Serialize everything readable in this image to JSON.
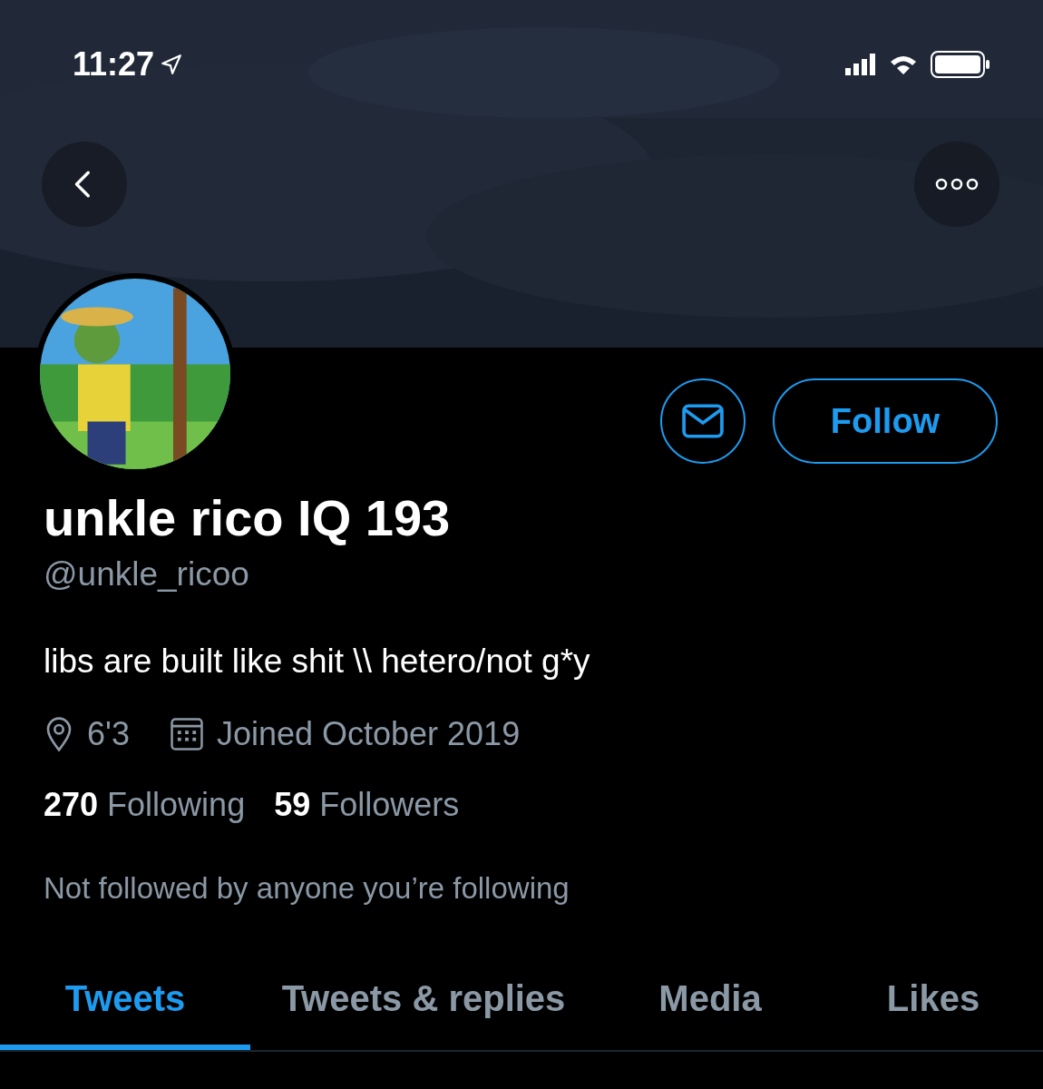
{
  "status_bar": {
    "time": "11:27"
  },
  "follow_button": "Follow",
  "profile": {
    "name": "unkle rico IQ 193",
    "handle": "@unkle_ricoo",
    "bio": "libs are built like shit \\\\ hetero/not g*y",
    "location": "6'3",
    "joined": "Joined October 2019",
    "following_count": "270",
    "following_label": "Following",
    "followers_count": "59",
    "followers_label": "Followers",
    "followed_by": "Not followed by anyone you’re following"
  },
  "tabs": [
    {
      "label": "Tweets",
      "selected": true
    },
    {
      "label": "Tweets & replies",
      "selected": false
    },
    {
      "label": "Media",
      "selected": false
    },
    {
      "label": "Likes",
      "selected": false
    }
  ]
}
